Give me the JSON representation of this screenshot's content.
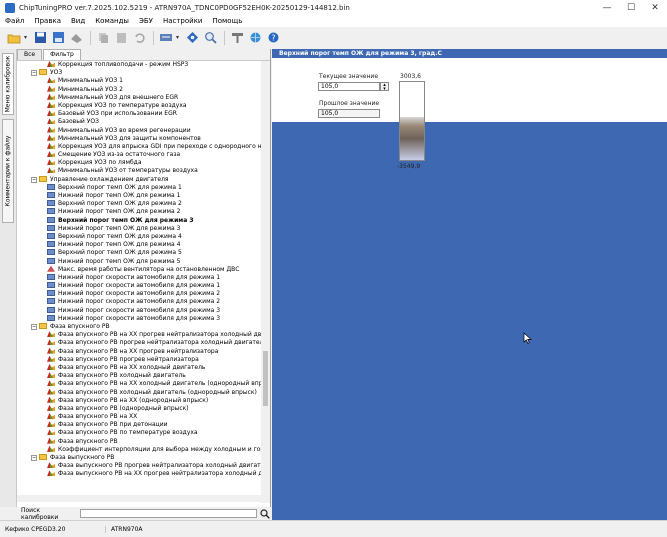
{
  "window": {
    "title": "ChipTuningPRO ver.7.2025.102.5219 - ATRN970A_TDNC0PD0GF52EH0K-20250129-144812.bin",
    "controls": [
      "minimize-icon",
      "maximize-icon",
      "close-icon"
    ]
  },
  "menu": [
    "Файл",
    "Правка",
    "Вид",
    "Команды",
    "ЭБУ",
    "Настройки",
    "Помощь"
  ],
  "toolbar": {
    "icons": [
      "open-folder-icon",
      "save-icon",
      "save-as-icon",
      "compare-icon",
      "copy-icon",
      "paste-icon",
      "undo-icon",
      "checksum-icon",
      "navigate-icon",
      "zoom-icon",
      "tools-icon",
      "network-icon",
      "help-icon"
    ]
  },
  "side_tabs": [
    "Меню калибровок",
    "Комментарии к файлу"
  ],
  "filter_tabs": [
    "Все",
    "Фильтр"
  ],
  "tree": [
    {
      "t": "Коррекция топливоподачи - режим HSP3",
      "icon": "flag",
      "lvl": 2
    },
    {
      "t": "УОЗ",
      "icon": "folder",
      "lvl": 1
    },
    {
      "t": "Минимальный УОЗ 1",
      "icon": "flag",
      "lvl": 2
    },
    {
      "t": "Минимальный УОЗ 2",
      "icon": "flag",
      "lvl": 2
    },
    {
      "t": "Минимальный УОЗ для внешнего EGR",
      "icon": "flag",
      "lvl": 2
    },
    {
      "t": "Коррекция УОЗ по температуре воздуха",
      "icon": "flag",
      "lvl": 2
    },
    {
      "t": "Базовый УОЗ при использовании EGR",
      "icon": "flag",
      "lvl": 2
    },
    {
      "t": "Базовый УОЗ",
      "icon": "flag",
      "lvl": 2
    },
    {
      "t": "Минимальный УОЗ во время регенерации",
      "icon": "flag",
      "lvl": 2
    },
    {
      "t": "Минимальный УОЗ для защиты компонентов",
      "icon": "flag",
      "lvl": 2
    },
    {
      "t": "Коррекция УОЗ для впрыска GDI при переходе с однородного на",
      "icon": "flag",
      "lvl": 2
    },
    {
      "t": "Смещение УОЗ из-за остаточного газа",
      "icon": "flag",
      "lvl": 2
    },
    {
      "t": "Коррекция УОЗ по лямбда",
      "icon": "flag",
      "lvl": 2
    },
    {
      "t": "Минимальный УОЗ от температуры воздуха",
      "icon": "flag",
      "lvl": 2
    },
    {
      "t": "Управление охлаждением двигателя",
      "icon": "folder",
      "lvl": 1
    },
    {
      "t": "Верхний порог темп ОЖ для режима 1",
      "icon": "table",
      "lvl": 2
    },
    {
      "t": "Нижний порог темп ОЖ для режима 1",
      "icon": "table",
      "lvl": 2
    },
    {
      "t": "Верхний порог темп ОЖ для режима 2",
      "icon": "table",
      "lvl": 2
    },
    {
      "t": "Нижний порог темп ОЖ для режима 2",
      "icon": "table",
      "lvl": 2
    },
    {
      "t": "Верхний порог темп ОЖ для режима 3",
      "icon": "table",
      "lvl": 2,
      "sel": true
    },
    {
      "t": "Нижний порог темп ОЖ для режима 3",
      "icon": "table",
      "lvl": 2
    },
    {
      "t": "Верхний порог темп ОЖ для режима 4",
      "icon": "table",
      "lvl": 2
    },
    {
      "t": "Нижний порог темп ОЖ для режима 4",
      "icon": "table",
      "lvl": 2
    },
    {
      "t": "Верхний порог темп ОЖ для режима 5",
      "icon": "table",
      "lvl": 2
    },
    {
      "t": "Нижний порог темп ОЖ для режима 5",
      "icon": "table",
      "lvl": 2
    },
    {
      "t": "Макс. время работы вентилятора на остановленном ДВС",
      "icon": "const",
      "lvl": 2
    },
    {
      "t": "Нижний порог скорости автомобиля для режима 1",
      "icon": "table",
      "lvl": 2
    },
    {
      "t": "Нижний порог скорости автомобиля для режима 1",
      "icon": "table",
      "lvl": 2
    },
    {
      "t": "Нижний порог скорости автомобиля для режима 2",
      "icon": "table",
      "lvl": 2
    },
    {
      "t": "Нижний порог скорости автомобиля для режима 2",
      "icon": "table",
      "lvl": 2
    },
    {
      "t": "Нижний порог скорости автомобиля для режима 3",
      "icon": "table",
      "lvl": 2
    },
    {
      "t": "Нижний порог скорости автомобиля для режима 3",
      "icon": "table",
      "lvl": 2
    },
    {
      "t": "Фаза впускного РВ",
      "icon": "folder",
      "lvl": 1
    },
    {
      "t": "Фаза впускного РВ на ХХ прогрев нейтрализатора холодный двигатель",
      "icon": "flag",
      "lvl": 2
    },
    {
      "t": "Фаза впускного РВ прогрев нейтрализатора холодный двигатель",
      "icon": "flag",
      "lvl": 2
    },
    {
      "t": "Фаза впускного РВ на ХХ прогрев нейтрализатора",
      "icon": "flag",
      "lvl": 2
    },
    {
      "t": "Фаза впускного РВ прогрев нейтрализатора",
      "icon": "flag",
      "lvl": 2
    },
    {
      "t": "Фаза впускного РВ на ХХ холодный двигатель",
      "icon": "flag",
      "lvl": 2
    },
    {
      "t": "Фаза впускного РВ холодный двигатель",
      "icon": "flag",
      "lvl": 2
    },
    {
      "t": "Фаза впускного РВ на ХХ холодный двигатель (однородный впрыск)",
      "icon": "flag",
      "lvl": 2
    },
    {
      "t": "Фаза впускного РВ холодный двигатель (однородный впрыск)",
      "icon": "flag",
      "lvl": 2
    },
    {
      "t": "Фаза впускного РВ на ХХ (однородный впрыск)",
      "icon": "flag",
      "lvl": 2
    },
    {
      "t": "Фаза впускного РВ (однородный впрыск)",
      "icon": "flag",
      "lvl": 2
    },
    {
      "t": "Фаза впускного РВ на ХХ",
      "icon": "flag",
      "lvl": 2
    },
    {
      "t": "Фаза впускного РВ при детонации",
      "icon": "flag",
      "lvl": 2
    },
    {
      "t": "Фаза впускного РВ по температуре воздуха",
      "icon": "flag",
      "lvl": 2
    },
    {
      "t": "Фаза впускного РВ",
      "icon": "flag",
      "lvl": 2
    },
    {
      "t": "Коэффициент интерполяции для выбора между холодным и горя",
      "icon": "flag",
      "lvl": 2
    },
    {
      "t": "Фаза выпускного РВ",
      "icon": "folder",
      "lvl": 1
    },
    {
      "t": "Фаза выпускного РВ прогрев нейтрализатора холодный двигатель",
      "icon": "flag",
      "lvl": 2
    },
    {
      "t": "Фаза выпускного РВ на ХХ прогрев нейтрализатора холодный двиг",
      "icon": "flag",
      "lvl": 2
    }
  ],
  "search": {
    "label": "Поиск калибровки",
    "value": ""
  },
  "editor": {
    "title": "Верхний порог темп ОЖ для режима 3, град.С",
    "current_label": "Текущее значение",
    "current_value": "105,0",
    "previous_label": "Прошлое значение",
    "previous_value": "105,0",
    "gauge_max": "3003,6",
    "gauge_min": "-3549,9",
    "gauge_level": 0.55
  },
  "status": [
    "Кефико CPEGD3.20",
    "ATRN970A"
  ]
}
